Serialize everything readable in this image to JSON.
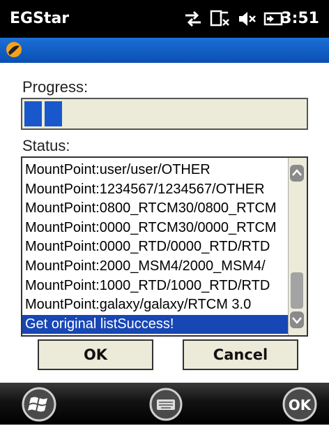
{
  "statusbar": {
    "app_title": "EGStar",
    "time": "3:51",
    "icons": [
      "connectivity-icon",
      "no-signal-icon",
      "volume-muted-icon",
      "battery-icon"
    ]
  },
  "header": {
    "logo_icon": "app-logo-icon",
    "accent_color": "#0a4fb3"
  },
  "progress": {
    "label": "Progress:",
    "fill_fraction": 0.14,
    "color": "#1858cc"
  },
  "status": {
    "label": "Status:",
    "items": [
      "MountPoint:user/user/OTHER",
      "MountPoint:1234567/1234567/OTHER",
      "MountPoint:0800_RTCM30/0800_RTCM",
      "MountPoint:0000_RTCM30/0000_RTCM",
      "MountPoint:0000_RTD/0000_RTD/RTD",
      "MountPoint:2000_MSM4/2000_MSM4/",
      "MountPoint:1000_RTD/1000_RTD/RTD",
      "MountPoint:galaxy/galaxy/RTCM 3.0",
      "Get original listSuccess!"
    ],
    "selected_index": 8
  },
  "buttons": {
    "ok_label": "OK",
    "cancel_label": "Cancel"
  },
  "bottombar": {
    "start_icon": "windows-start-icon",
    "keyboard_icon": "keyboard-icon",
    "ok_softkey": "OK"
  }
}
